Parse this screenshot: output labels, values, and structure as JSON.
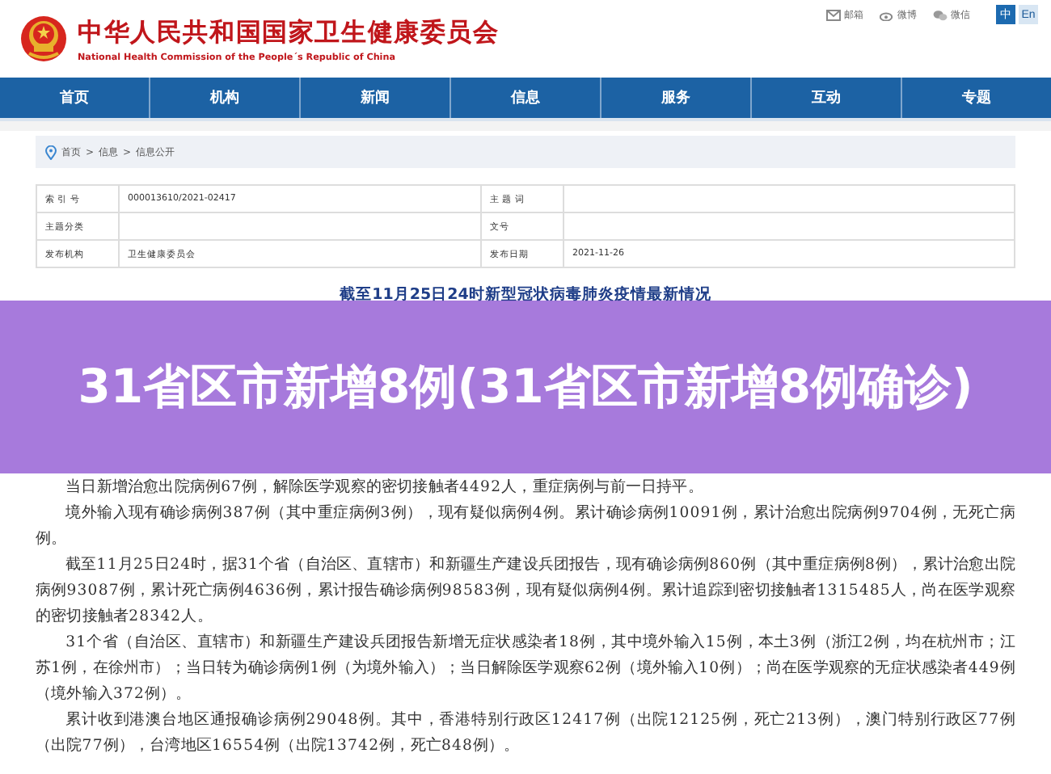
{
  "header": {
    "title": "中华人民共和国国家卫生健康委员会",
    "subtitle": "National Health Commission of the People´s Republic of China",
    "links": [
      {
        "kind": "mail",
        "label": "邮箱"
      },
      {
        "kind": "weibo",
        "label": "微博"
      },
      {
        "kind": "wechat",
        "label": "微信"
      }
    ],
    "languages": [
      {
        "label": "中",
        "selected": true
      },
      {
        "label": "En",
        "selected": false
      }
    ]
  },
  "nav": [
    {
      "label": "首页"
    },
    {
      "label": "机构"
    },
    {
      "label": "新闻"
    },
    {
      "label": "信息"
    },
    {
      "label": "服务"
    },
    {
      "label": "互动"
    },
    {
      "label": "专题"
    }
  ],
  "breadcrumb": [
    "首页",
    "信息",
    "信息公开"
  ],
  "breadcrumb_separator": ">",
  "info_table": [
    [
      {
        "label": "索 引 号",
        "value": "000013610/2021-02417"
      },
      {
        "label": "主 题 词"
      }
    ],
    [
      {
        "label": "主题分类"
      },
      {
        "label": "文号"
      }
    ],
    [
      {
        "label": "发布机构",
        "value": "卫生健康委员会"
      },
      {
        "label": "发布日期",
        "value": "2021-11-26"
      }
    ]
  ],
  "article": {
    "heading": "截至11月25日24时新型冠状病毒肺炎疫情最新情况",
    "paragraphs": [
      "当日新增治愈出院病例67例，解除医学观察的密切接触者4492人，重症病例与前一日持平。",
      "境外输入现有确诊病例387例（其中重症病例3例），现有疑似病例4例。累计确诊病例10091例，累计治愈出院病例9704例，无死亡病例。",
      "截至11月25日24时，据31个省（自治区、直辖市）和新疆生产建设兵团报告，现有确诊病例860例（其中重症病例8例），累计治愈出院病例93087例，累计死亡病例4636例，累计报告确诊病例98583例，现有疑似病例4例。累计追踪到密切接触者1315485人，尚在医学观察的密切接触者28342人。",
      "31个省（自治区、直辖市）和新疆生产建设兵团报告新增无症状感染者18例，其中境外输入15例，本土3例（浙江2例，均在杭州市；江苏1例，在徐州市）；当日转为确诊病例1例（为境外输入）；当日解除医学观察62例（境外输入10例）；尚在医学观察的无症状感染者449例（境外输入372例）。",
      "累计收到港澳台地区通报确诊病例29048例。其中，香港特别行政区12417例（出院12125例，死亡213例），澳门特别行政区77例（出院77例），台湾地区16554例（出院13742例，死亡848例）。"
    ]
  },
  "banner": {
    "title": "31省区市新增8例(31省区市新增8例确诊)"
  }
}
